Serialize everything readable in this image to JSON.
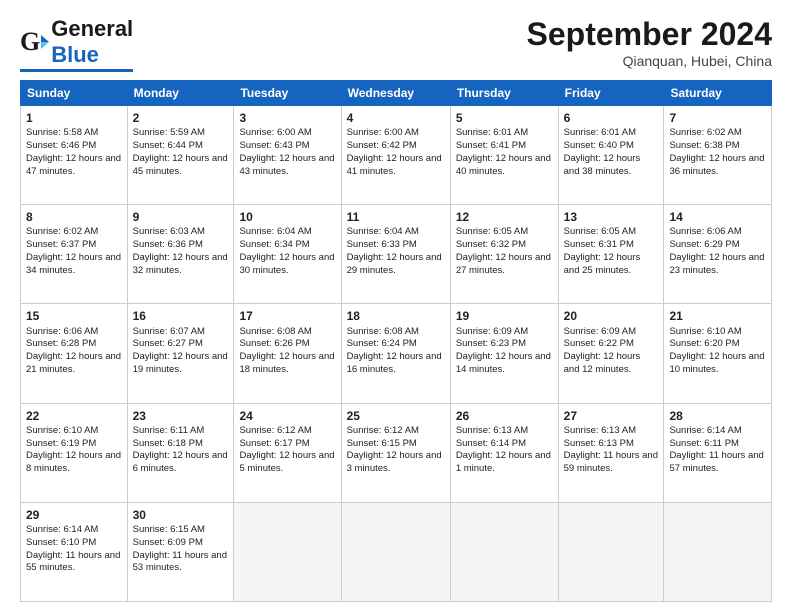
{
  "header": {
    "logo_general": "General",
    "logo_blue": "Blue",
    "month_title": "September 2024",
    "location": "Qianquan, Hubei, China"
  },
  "days_of_week": [
    "Sunday",
    "Monday",
    "Tuesday",
    "Wednesday",
    "Thursday",
    "Friday",
    "Saturday"
  ],
  "weeks": [
    [
      {
        "num": "1",
        "rise": "Sunrise: 5:58 AM",
        "set": "Sunset: 6:46 PM",
        "daylight": "Daylight: 12 hours and 47 minutes."
      },
      {
        "num": "2",
        "rise": "Sunrise: 5:59 AM",
        "set": "Sunset: 6:44 PM",
        "daylight": "Daylight: 12 hours and 45 minutes."
      },
      {
        "num": "3",
        "rise": "Sunrise: 6:00 AM",
        "set": "Sunset: 6:43 PM",
        "daylight": "Daylight: 12 hours and 43 minutes."
      },
      {
        "num": "4",
        "rise": "Sunrise: 6:00 AM",
        "set": "Sunset: 6:42 PM",
        "daylight": "Daylight: 12 hours and 41 minutes."
      },
      {
        "num": "5",
        "rise": "Sunrise: 6:01 AM",
        "set": "Sunset: 6:41 PM",
        "daylight": "Daylight: 12 hours and 40 minutes."
      },
      {
        "num": "6",
        "rise": "Sunrise: 6:01 AM",
        "set": "Sunset: 6:40 PM",
        "daylight": "Daylight: 12 hours and 38 minutes."
      },
      {
        "num": "7",
        "rise": "Sunrise: 6:02 AM",
        "set": "Sunset: 6:38 PM",
        "daylight": "Daylight: 12 hours and 36 minutes."
      }
    ],
    [
      {
        "num": "8",
        "rise": "Sunrise: 6:02 AM",
        "set": "Sunset: 6:37 PM",
        "daylight": "Daylight: 12 hours and 34 minutes."
      },
      {
        "num": "9",
        "rise": "Sunrise: 6:03 AM",
        "set": "Sunset: 6:36 PM",
        "daylight": "Daylight: 12 hours and 32 minutes."
      },
      {
        "num": "10",
        "rise": "Sunrise: 6:04 AM",
        "set": "Sunset: 6:34 PM",
        "daylight": "Daylight: 12 hours and 30 minutes."
      },
      {
        "num": "11",
        "rise": "Sunrise: 6:04 AM",
        "set": "Sunset: 6:33 PM",
        "daylight": "Daylight: 12 hours and 29 minutes."
      },
      {
        "num": "12",
        "rise": "Sunrise: 6:05 AM",
        "set": "Sunset: 6:32 PM",
        "daylight": "Daylight: 12 hours and 27 minutes."
      },
      {
        "num": "13",
        "rise": "Sunrise: 6:05 AM",
        "set": "Sunset: 6:31 PM",
        "daylight": "Daylight: 12 hours and 25 minutes."
      },
      {
        "num": "14",
        "rise": "Sunrise: 6:06 AM",
        "set": "Sunset: 6:29 PM",
        "daylight": "Daylight: 12 hours and 23 minutes."
      }
    ],
    [
      {
        "num": "15",
        "rise": "Sunrise: 6:06 AM",
        "set": "Sunset: 6:28 PM",
        "daylight": "Daylight: 12 hours and 21 minutes."
      },
      {
        "num": "16",
        "rise": "Sunrise: 6:07 AM",
        "set": "Sunset: 6:27 PM",
        "daylight": "Daylight: 12 hours and 19 minutes."
      },
      {
        "num": "17",
        "rise": "Sunrise: 6:08 AM",
        "set": "Sunset: 6:26 PM",
        "daylight": "Daylight: 12 hours and 18 minutes."
      },
      {
        "num": "18",
        "rise": "Sunrise: 6:08 AM",
        "set": "Sunset: 6:24 PM",
        "daylight": "Daylight: 12 hours and 16 minutes."
      },
      {
        "num": "19",
        "rise": "Sunrise: 6:09 AM",
        "set": "Sunset: 6:23 PM",
        "daylight": "Daylight: 12 hours and 14 minutes."
      },
      {
        "num": "20",
        "rise": "Sunrise: 6:09 AM",
        "set": "Sunset: 6:22 PM",
        "daylight": "Daylight: 12 hours and 12 minutes."
      },
      {
        "num": "21",
        "rise": "Sunrise: 6:10 AM",
        "set": "Sunset: 6:20 PM",
        "daylight": "Daylight: 12 hours and 10 minutes."
      }
    ],
    [
      {
        "num": "22",
        "rise": "Sunrise: 6:10 AM",
        "set": "Sunset: 6:19 PM",
        "daylight": "Daylight: 12 hours and 8 minutes."
      },
      {
        "num": "23",
        "rise": "Sunrise: 6:11 AM",
        "set": "Sunset: 6:18 PM",
        "daylight": "Daylight: 12 hours and 6 minutes."
      },
      {
        "num": "24",
        "rise": "Sunrise: 6:12 AM",
        "set": "Sunset: 6:17 PM",
        "daylight": "Daylight: 12 hours and 5 minutes."
      },
      {
        "num": "25",
        "rise": "Sunrise: 6:12 AM",
        "set": "Sunset: 6:15 PM",
        "daylight": "Daylight: 12 hours and 3 minutes."
      },
      {
        "num": "26",
        "rise": "Sunrise: 6:13 AM",
        "set": "Sunset: 6:14 PM",
        "daylight": "Daylight: 12 hours and 1 minute."
      },
      {
        "num": "27",
        "rise": "Sunrise: 6:13 AM",
        "set": "Sunset: 6:13 PM",
        "daylight": "Daylight: 11 hours and 59 minutes."
      },
      {
        "num": "28",
        "rise": "Sunrise: 6:14 AM",
        "set": "Sunset: 6:11 PM",
        "daylight": "Daylight: 11 hours and 57 minutes."
      }
    ],
    [
      {
        "num": "29",
        "rise": "Sunrise: 6:14 AM",
        "set": "Sunset: 6:10 PM",
        "daylight": "Daylight: 11 hours and 55 minutes."
      },
      {
        "num": "30",
        "rise": "Sunrise: 6:15 AM",
        "set": "Sunset: 6:09 PM",
        "daylight": "Daylight: 11 hours and 53 minutes."
      },
      null,
      null,
      null,
      null,
      null
    ]
  ]
}
